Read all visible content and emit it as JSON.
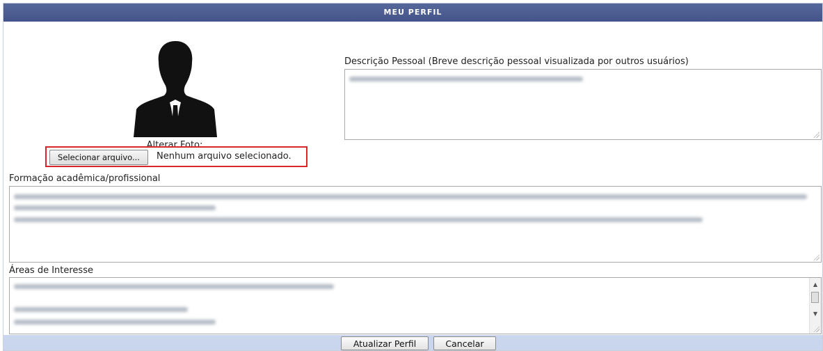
{
  "header": {
    "title": "MEU PERFIL"
  },
  "photo": {
    "alt": "avatar silhouette",
    "icon": "person-silhouette-icon"
  },
  "photo_upload": {
    "label": "Alterar Foto:",
    "button_label": "Selecionar arquivo...",
    "status": "Nenhum arquivo selecionado."
  },
  "description": {
    "label": "Descrição Pessoal (Breve descrição pessoal visualizada por outros usuários)"
  },
  "formation": {
    "label": "Formação acadêmica/profissional"
  },
  "interests": {
    "label": "Áreas de Interesse"
  },
  "actions": {
    "update_label": "Atualizar Perfil",
    "cancel_label": "Cancelar"
  }
}
